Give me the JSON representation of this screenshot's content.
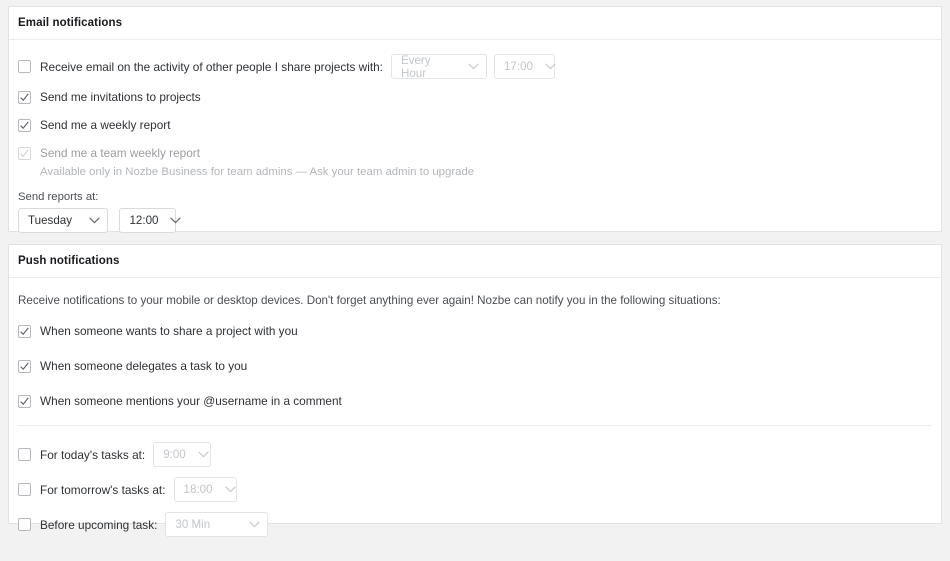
{
  "email_section": {
    "title": "Email notifications",
    "rows": [
      {
        "label": "Receive email on the activity of other people I share projects with:",
        "checked": false,
        "disabled": false,
        "selects": [
          {
            "name": "activity-frequency-select",
            "value": "Every Hour",
            "disabled": true
          },
          {
            "name": "activity-time-select",
            "value": "17:00",
            "disabled": true
          }
        ]
      },
      {
        "label": "Send me invitations to projects",
        "checked": true,
        "disabled": false
      },
      {
        "label": "Send me a weekly report",
        "checked": true,
        "disabled": false
      },
      {
        "label": "Send me a team weekly report",
        "checked": true,
        "disabled": true,
        "note": "Available only in Nozbe Business for team admins — Ask your team admin to upgrade"
      }
    ],
    "reports_label": "Send reports at:",
    "reports_day": "Tuesday",
    "reports_time": "12:00"
  },
  "push_section": {
    "title": "Push notifications",
    "intro": "Receive notifications to your mobile or desktop devices. Don't forget anything ever again! Nozbe can notify you in the following situations:",
    "rows": [
      {
        "label": "When someone wants to share a project with you",
        "checked": true
      },
      {
        "label": "When someone delegates a task to you",
        "checked": true
      },
      {
        "label": "When someone mentions your @username in a comment",
        "checked": true
      }
    ],
    "timed_rows": [
      {
        "label": "For today's tasks at:",
        "checked": false,
        "value": "9:00"
      },
      {
        "label": "For tomorrow's tasks at:",
        "checked": false,
        "value": "18:00"
      },
      {
        "label": "Before upcoming task:",
        "checked": false,
        "value": "30 Min"
      }
    ]
  },
  "colors": {
    "page_background": "#f2f2f2",
    "card_background": "#ffffff",
    "card_border": "#e2e2e2",
    "text_primary": "#2e3135",
    "text_muted": "#9a9da1",
    "text_disabled": "#c2c5c9"
  }
}
